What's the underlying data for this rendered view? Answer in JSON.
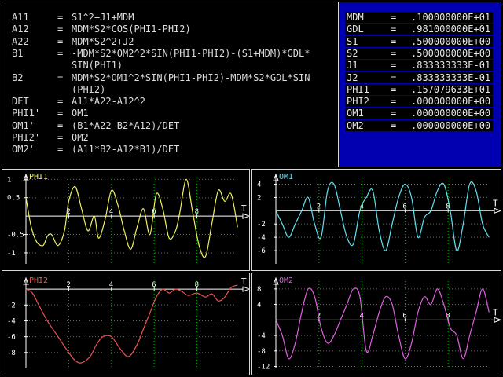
{
  "equations": [
    {
      "lhs": "A11",
      "rhs": "S1^2+J1+MDM"
    },
    {
      "lhs": "A12",
      "rhs": "MDM*S2*COS(PHI1-PHI2)"
    },
    {
      "lhs": "A22",
      "rhs": "MDM*S2^2+J2"
    },
    {
      "lhs": "B1",
      "rhs": "-MDM*S2*OM2^2*SIN(PHI1-PHI2)-(S1+MDM)*GDL*"
    },
    {
      "lhs": "",
      "rhs": "SIN(PHI1)"
    },
    {
      "lhs": "B2",
      "rhs": "MDM*S2*OM1^2*SIN(PHI1-PHI2)-MDM*S2*GDL*SIN"
    },
    {
      "lhs": "",
      "rhs": "(PHI2)"
    },
    {
      "lhs": "DET",
      "rhs": "A11*A22-A12^2"
    },
    {
      "lhs": "PHI1'",
      "rhs": "OM1"
    },
    {
      "lhs": "OM1'",
      "rhs": "(B1*A22-B2*A12)/DET"
    },
    {
      "lhs": "PHI2'",
      "rhs": "OM2"
    },
    {
      "lhs": "OM2'",
      "rhs": "(A11*B2-A12*B1)/DET"
    }
  ],
  "params": [
    {
      "name": "MDM",
      "value": ".100000000E+01"
    },
    {
      "name": "GDL",
      "value": ".981000000E+01"
    },
    {
      "name": "S1",
      "value": ".500000000E+00"
    },
    {
      "name": "S2",
      "value": ".500000000E+00"
    },
    {
      "name": "J1",
      "value": ".833333333E-01"
    },
    {
      "name": "J2",
      "value": ".833333333E-01"
    },
    {
      "name": "PHI1",
      "value": ".157079633E+01"
    },
    {
      "name": "PHI2",
      "value": ".000000000E+00"
    },
    {
      "name": "OM1",
      "value": ".000000000E+00"
    },
    {
      "name": "OM2",
      "value": ".000000000E+00"
    }
  ],
  "colors": {
    "param_bg": "#0000b0",
    "axis": "#ffffff",
    "grid": "#00b000",
    "phi1": "#f0f060",
    "om1": "#60e0f0",
    "phi2": "#f05050",
    "om2": "#e060e0"
  },
  "chart_data": [
    {
      "type": "line",
      "title": "PHI1",
      "xlabel": "T",
      "color": "#f0f060",
      "xlim": [
        0,
        10
      ],
      "ylim": [
        -1.3,
        1.05
      ],
      "xticks": [
        "2",
        "4",
        "6",
        "8"
      ],
      "yticks": [
        "1",
        "0.5",
        "-0.5",
        "-1"
      ],
      "x": [
        0,
        0.25,
        0.5,
        0.8,
        1.0,
        1.2,
        1.5,
        1.8,
        2.0,
        2.3,
        2.6,
        2.9,
        3.2,
        3.4,
        3.7,
        4.0,
        4.3,
        4.6,
        4.9,
        5.2,
        5.5,
        5.8,
        6.1,
        6.4,
        6.7,
        7.0,
        7.2,
        7.5,
        7.8,
        8.1,
        8.4,
        8.7,
        9.0,
        9.3,
        9.6,
        9.9
      ],
      "y": [
        0.5,
        -0.3,
        -0.7,
        -0.8,
        -0.55,
        -0.5,
        -0.8,
        -0.4,
        0.4,
        0.8,
        0.2,
        -0.4,
        0.0,
        -0.6,
        -0.1,
        0.7,
        0.3,
        -0.4,
        -0.9,
        -0.3,
        0.2,
        -0.5,
        0.6,
        0.2,
        -0.6,
        -0.4,
        0.1,
        1.0,
        0.1,
        -0.8,
        -1.1,
        -0.2,
        0.7,
        0.4,
        0.6,
        -0.3
      ]
    },
    {
      "type": "line",
      "title": "OM1",
      "xlabel": "T",
      "color": "#60e0f0",
      "xlim": [
        0,
        10
      ],
      "ylim": [
        -8,
        5
      ],
      "xticks": [
        "2",
        "4",
        "6",
        "8"
      ],
      "yticks": [
        "4",
        "2",
        "-2",
        "-4",
        "-6"
      ],
      "x": [
        0,
        0.3,
        0.6,
        0.9,
        1.2,
        1.5,
        1.8,
        2.1,
        2.4,
        2.7,
        3.0,
        3.3,
        3.6,
        3.9,
        4.2,
        4.5,
        4.8,
        5.1,
        5.4,
        5.7,
        6.0,
        6.3,
        6.6,
        6.9,
        7.2,
        7.5,
        7.8,
        8.1,
        8.4,
        8.7,
        9.0,
        9.3,
        9.6,
        9.9
      ],
      "y": [
        0,
        -2,
        -4,
        -2,
        0,
        2,
        -2,
        -4,
        3,
        4,
        0,
        -4,
        -5,
        0,
        2,
        3,
        -3,
        -6,
        -2,
        2,
        4,
        2,
        -4,
        -1,
        0,
        3,
        4,
        0,
        -6,
        -2,
        4,
        3,
        -2,
        -4
      ]
    },
    {
      "type": "line",
      "title": "PHI2",
      "xlabel": "T",
      "color": "#f05050",
      "xlim": [
        0,
        10
      ],
      "ylim": [
        -10,
        1
      ],
      "xticks": [
        "2",
        "4",
        "6",
        "8"
      ],
      "yticks": [
        "-2",
        "-4",
        "-6",
        "-8"
      ],
      "x": [
        0,
        0.3,
        0.6,
        1.0,
        1.5,
        2.0,
        2.3,
        2.6,
        3.0,
        3.3,
        3.6,
        4.0,
        4.4,
        4.8,
        5.2,
        5.5,
        5.8,
        6.1,
        6.4,
        6.7,
        7.0,
        7.3,
        7.6,
        8.0,
        8.4,
        8.7,
        9.0,
        9.3,
        9.6,
        9.9
      ],
      "y": [
        0,
        -0.5,
        -2,
        -4,
        -6,
        -8,
        -9,
        -9.3,
        -8.5,
        -7,
        -6,
        -6,
        -7.5,
        -8.5,
        -7,
        -5,
        -3,
        -1,
        0,
        -0.5,
        0,
        -0.3,
        -0.8,
        -0.5,
        -1,
        -0.6,
        -1.5,
        -1,
        0.2,
        0.5
      ]
    },
    {
      "type": "line",
      "title": "OM2",
      "xlabel": "T",
      "color": "#e060e0",
      "xlim": [
        0,
        10
      ],
      "ylim": [
        -12.5,
        10
      ],
      "xticks": [
        "2",
        "4",
        "6",
        "8"
      ],
      "yticks": [
        "8",
        "4",
        "-4",
        "-8",
        "-12"
      ],
      "x": [
        0,
        0.3,
        0.6,
        0.9,
        1.2,
        1.5,
        1.8,
        2.1,
        2.4,
        2.7,
        3.0,
        3.3,
        3.6,
        3.9,
        4.2,
        4.5,
        4.8,
        5.1,
        5.4,
        5.7,
        6.0,
        6.3,
        6.6,
        6.9,
        7.2,
        7.5,
        7.8,
        8.1,
        8.4,
        8.7,
        9.0,
        9.3,
        9.6,
        9.9
      ],
      "y": [
        0,
        -4,
        -10,
        -6,
        2,
        8,
        6,
        -2,
        -6,
        -4,
        0,
        4,
        8,
        6,
        -8,
        -4,
        2,
        6,
        4,
        -4,
        -10,
        -6,
        2,
        6,
        4,
        8,
        4,
        -2,
        -4,
        -10,
        -4,
        2,
        8,
        2
      ]
    }
  ]
}
